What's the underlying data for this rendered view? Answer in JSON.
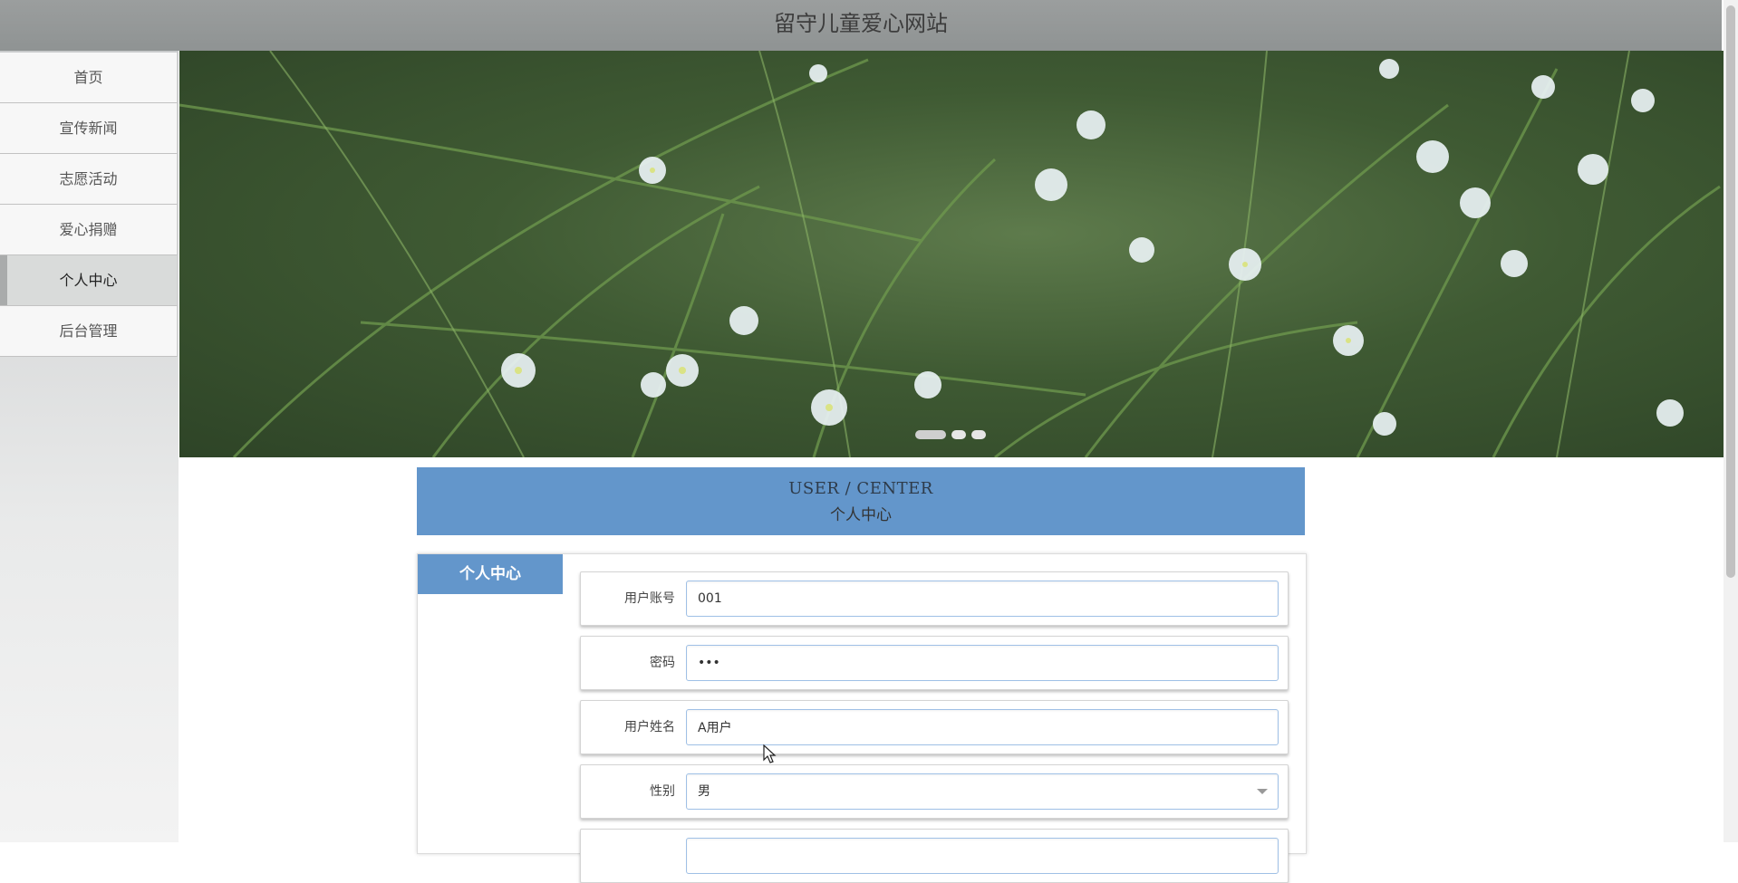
{
  "header": {
    "title": "留守儿童爱心网站"
  },
  "sidebar": {
    "items": [
      {
        "label": "首页",
        "active": false
      },
      {
        "label": "宣传新闻",
        "active": false
      },
      {
        "label": "志愿活动",
        "active": false
      },
      {
        "label": "爱心捐赠",
        "active": false
      },
      {
        "label": "个人中心",
        "active": true
      },
      {
        "label": "后台管理",
        "active": false
      }
    ]
  },
  "banner": {
    "slide_count": 3,
    "active_slide": 1
  },
  "section": {
    "title_en": "USER / CENTER",
    "title_cn": "个人中心"
  },
  "panel": {
    "tab_label": "个人中心",
    "fields": [
      {
        "label": "用户账号",
        "value": "001",
        "type": "text"
      },
      {
        "label": "密码",
        "value": "•••",
        "type": "password"
      },
      {
        "label": "用户姓名",
        "value": "A用户",
        "type": "text"
      },
      {
        "label": "性别",
        "value": "男",
        "type": "select"
      }
    ]
  },
  "colors": {
    "accent": "#6396cb",
    "topbar": "#959999",
    "active_nav": "#d9dbda"
  }
}
